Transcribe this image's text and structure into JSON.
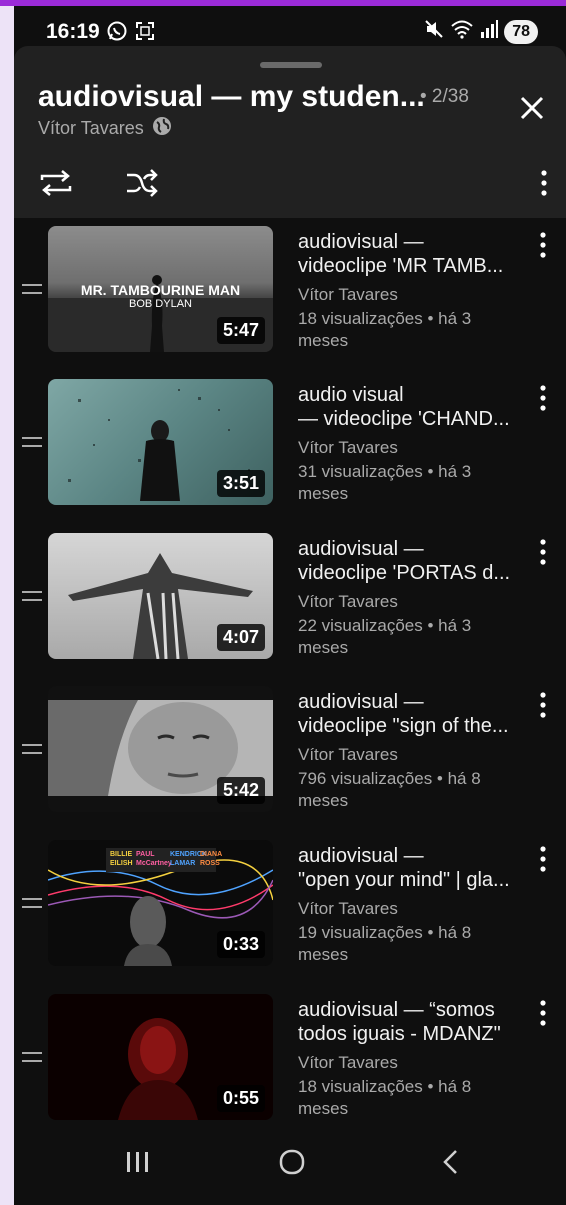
{
  "status_bar": {
    "time": "16:19",
    "battery": "78",
    "icons": [
      "whatsapp-icon",
      "screenshot-icon",
      "mute-icon",
      "wifi-icon",
      "signal-icon"
    ]
  },
  "playlist": {
    "title": "audiovisual — my studen...",
    "position": "• 2/38",
    "owner": "Vítor Tavares",
    "visibility_icon": "globe-icon"
  },
  "videos": [
    {
      "title": "audiovisual —\nvideoclipe 'MR TAMB...",
      "channel": "Vítor Tavares",
      "stats": "18 visualizações • há 3\nmeses",
      "duration": "5:47",
      "thumb_text": "MR. TAMBOURINE MAN",
      "thumb_subtext": "BOB DYLAN"
    },
    {
      "title": "audio visual\n— videoclipe 'CHAND...",
      "channel": "Vítor Tavares",
      "stats": "31 visualizações • há 3\nmeses",
      "duration": "3:51"
    },
    {
      "title": "audiovisual —\nvideoclipe 'PORTAS d...",
      "channel": "Vítor Tavares",
      "stats": "22 visualizações • há 3\nmeses",
      "duration": "4:07"
    },
    {
      "title": "audiovisual —\nvideoclipe \"sign of the...",
      "channel": "Vítor Tavares",
      "stats": "796 visualizações • há 8\nmeses",
      "duration": "5:42"
    },
    {
      "title": "audiovisual —\n\"open your mind\" | gla...",
      "channel": "Vítor Tavares",
      "stats": "19 visualizações • há 8\nmeses",
      "duration": "0:33",
      "thumb_names": [
        "BILLIE",
        "EILISH",
        "PAUL",
        "McCartney",
        "KENDRICK",
        "LAMAR",
        "DIANA",
        "ROSS"
      ]
    },
    {
      "title": "audiovisual — “somos\ntodos iguais - MDANZ\"",
      "channel": "Vítor Tavares",
      "stats": "18 visualizações • há 8\nmeses",
      "duration": "0:55"
    }
  ],
  "colors": {
    "background": "#0f0f0f",
    "panel": "#212121",
    "text_primary": "#f1f1f1",
    "text_secondary": "#aaaaaa",
    "outer_background": "#ede3f7",
    "accent": "#9b2bd8"
  }
}
